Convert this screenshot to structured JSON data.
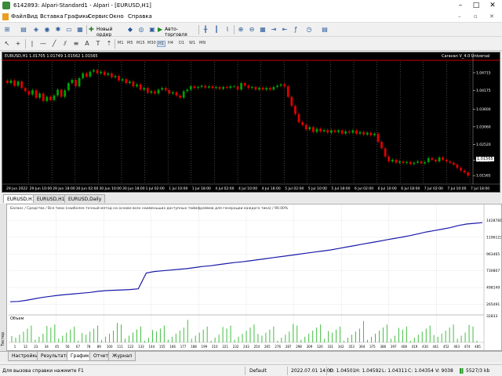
{
  "window": {
    "title": "6142893: Alpari-Standard1 - Alpari - [EURUSD,H1]"
  },
  "menu": [
    "Файл",
    "Вид",
    "Вставка",
    "Графики",
    "Сервис",
    "Окно",
    "Справка"
  ],
  "toolbar": {
    "new_order": "Новый ордер",
    "autotrading": "Авто-торговля",
    "timeframes": [
      "M1",
      "M5",
      "M15",
      "M30",
      "H1",
      "H4",
      "D1",
      "W1",
      "MN"
    ]
  },
  "chart": {
    "symbol_info": "EURUSD,H1  1.01705 1.01749 1.01562 1.01565",
    "expert": "Caravan V_4.0 Universal",
    "price_labels": [
      "1.04715",
      "1.04175",
      "1.03600",
      "1.03060",
      "1.02520",
      "1.02030",
      "1.01565"
    ],
    "current_price": "1.01565",
    "time_labels": [
      "29 Jun 2022",
      "29 Jun 10:00",
      "29 Jun 18:00",
      "30 Jun 02:00",
      "30 Jun 10:00",
      "30 Jun 18:00",
      "1 Jul 02:00",
      "1 Jul 10:00",
      "1 Jul 18:00",
      "4 Jul 02:00",
      "4 Jul 10:00",
      "4 Jul 18:00",
      "5 Jul 02:00",
      "5 Jul 10:00",
      "5 Jul 18:00",
      "6 Jul 02:00",
      "6 Jul 10:00",
      "6 Jul 18:00",
      "7 Jul 02:00",
      "7 Jul 10:00",
      "7 Jul 18:00"
    ]
  },
  "chart_data": {
    "type": "candlestick",
    "symbol": "EURUSD",
    "timeframe": "H1",
    "last": {
      "open": 1.01705,
      "high": 1.01749,
      "low": 1.01562,
      "close": 1.01565
    },
    "ylim": [
      1.014,
      1.0505
    ],
    "closes": [
      1.044,
      1.0448,
      1.0432,
      1.0445,
      1.0425,
      1.0415,
      1.0405,
      1.0418,
      1.0395,
      1.0408,
      1.0385,
      1.0398,
      1.0388,
      1.0402,
      1.042,
      1.0398,
      1.0418,
      1.044,
      1.045,
      1.043,
      1.0455,
      1.047,
      1.046,
      1.0475,
      1.048,
      1.047,
      1.0475,
      1.0465,
      1.047,
      1.0458,
      1.0462,
      1.0448,
      1.0452,
      1.044,
      1.0445,
      1.043,
      1.0436,
      1.042,
      1.0425,
      1.041,
      1.0415,
      1.0408,
      1.042,
      1.0425,
      1.0418,
      1.0408,
      1.0412,
      1.0402,
      1.0395,
      1.0415,
      1.042,
      1.043,
      1.0425,
      1.0428,
      1.0432,
      1.0426,
      1.043,
      1.0425,
      1.0428,
      1.0422,
      1.0428,
      1.0425,
      1.043,
      1.043,
      1.042,
      1.044,
      1.0432,
      1.0425,
      1.0428,
      1.042,
      1.0426,
      1.042,
      1.0425,
      1.042,
      1.0428,
      1.0432,
      1.0436,
      1.043,
      1.0398,
      1.037,
      1.0345,
      1.032,
      1.0312,
      1.0298,
      1.0305,
      1.029,
      1.03,
      1.0292,
      1.0296,
      1.0288,
      1.0295,
      1.029,
      1.0295,
      1.0285,
      1.0292,
      1.0288,
      1.0295,
      1.0285,
      1.029,
      1.0282,
      1.0288,
      1.028,
      1.0285,
      1.026,
      1.024,
      1.0215,
      1.02,
      1.0205,
      1.0196,
      1.02,
      1.0195,
      1.0198,
      1.0192,
      1.0196,
      1.02,
      1.0194,
      1.0198,
      1.021,
      1.0205,
      1.02,
      1.0212,
      1.0205,
      1.02,
      1.0196,
      1.019,
      1.018,
      1.0172,
      1.0166,
      1.01565
    ],
    "balance_labels": [
      "1428781",
      "1196123",
      "963465",
      "730807",
      "498149",
      "265491"
    ],
    "balance_ylim": [
      150000,
      1500000
    ],
    "balance": [
      300000,
      305000,
      320000,
      340000,
      360000,
      375000,
      390000,
      400000,
      410000,
      420000,
      430000,
      445000,
      455000,
      460000,
      465000,
      470000,
      480000,
      700000,
      720000,
      730000,
      740000,
      750000,
      760000,
      775000,
      790000,
      800000,
      815000,
      830000,
      845000,
      855000,
      870000,
      885000,
      900000,
      915000,
      930000,
      945000,
      960000,
      975000,
      990000,
      1005000,
      1020000,
      1040000,
      1060000,
      1080000,
      1100000,
      1120000,
      1140000,
      1160000,
      1180000,
      1200000,
      1220000,
      1245000,
      1270000,
      1290000,
      1310000,
      1330000,
      1360000,
      1380000,
      1390000,
      1400000
    ],
    "volume_label": "32833",
    "volume_axis": [
      "1",
      "12",
      "23",
      "34",
      "45",
      "56",
      "67",
      "78",
      "89",
      "100",
      "111",
      "122",
      "133",
      "144",
      "155",
      "166",
      "177",
      "188",
      "199",
      "210",
      "221",
      "232",
      "243",
      "254",
      "265",
      "276",
      "287",
      "298",
      "309",
      "320",
      "331",
      "342",
      "353",
      "364",
      "375",
      "386",
      "397",
      "408",
      "419",
      "430",
      "441",
      "452",
      "463",
      "474",
      "485"
    ]
  },
  "subtabs": [
    "EURUSD,H1",
    "EURUSD,H1",
    "EURUSD,Daily"
  ],
  "tester": {
    "legend": "Баланс / Средства / Все тики (наиболее точный метод на основе всех наименьших доступных таймфреймов для генерации каждого тика) / 90.00%",
    "volume_title": "Объем",
    "side_label": "Тестер"
  },
  "bottom_tabs": [
    "Настройки",
    "Результаты",
    "График",
    "Отчет",
    "Журнал"
  ],
  "status": {
    "help": "Для вызова справки нажмите F1",
    "profile": "Default",
    "time": "2022.07.01 14:00",
    "open": "O: 1.04501",
    "high": "H: 1.04592",
    "low": "L: 1.04311",
    "close": "C: 1.04354",
    "volume": "V: 9038",
    "traffic": "5527/3 kb"
  },
  "colors": {
    "bull": "#00a000",
    "bear": "#e00000",
    "balance": "#1a1aa8",
    "volume": "#2db82d",
    "grid": "#888888"
  }
}
